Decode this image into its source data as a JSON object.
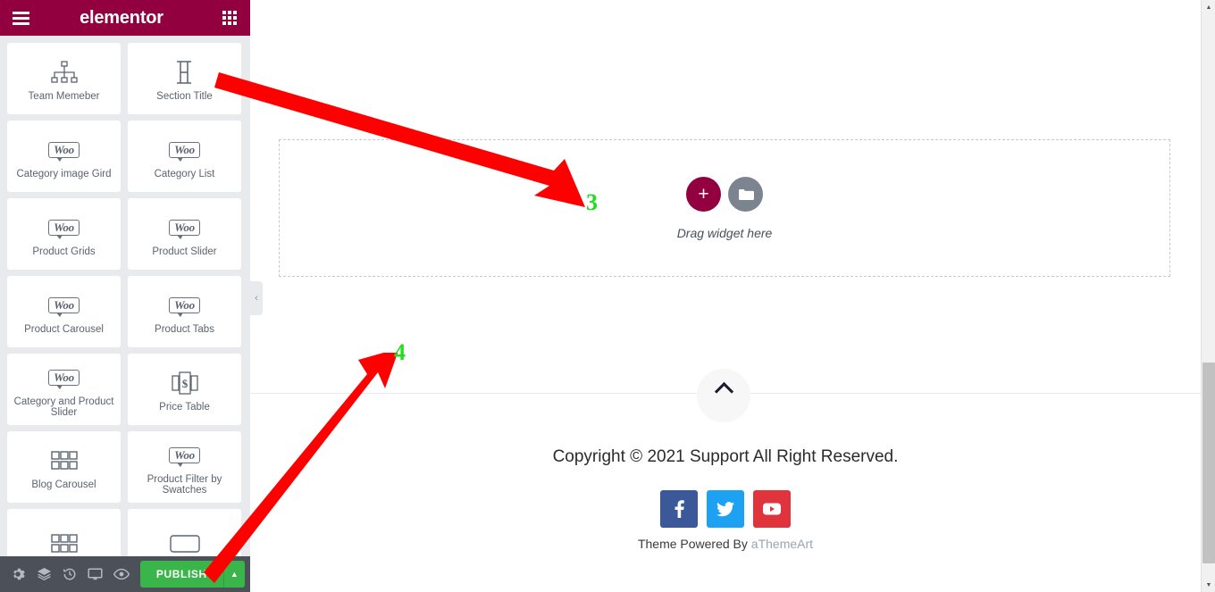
{
  "panel": {
    "logo": "elementor",
    "menu_icon": "hamburger-icon",
    "grid_icon": "apps-grid-icon",
    "collapse_icon": "‹",
    "widgets": [
      {
        "label": "Team Memeber",
        "icon": "sitemap-icon"
      },
      {
        "label": "Section Title",
        "icon": "heading-h-icon"
      },
      {
        "label": "Category image Gird",
        "icon": "woo-icon"
      },
      {
        "label": "Category List",
        "icon": "woo-icon"
      },
      {
        "label": "Product Grids",
        "icon": "woo-icon"
      },
      {
        "label": "Product Slider",
        "icon": "woo-icon"
      },
      {
        "label": "Product Carousel",
        "icon": "woo-icon"
      },
      {
        "label": "Product Tabs",
        "icon": "woo-icon"
      },
      {
        "label": "Category and Product Slider",
        "icon": "woo-icon"
      },
      {
        "label": "Price Table",
        "icon": "price-table-icon"
      },
      {
        "label": "Blog Carousel",
        "icon": "grid-blocks-icon"
      },
      {
        "label": "Product Filter by Swatches",
        "icon": "woo-icon"
      },
      {
        "label": "",
        "icon": "grid-blocks-icon"
      },
      {
        "label": "",
        "icon": "box-outline-icon"
      }
    ],
    "woo_text": "Woo"
  },
  "bottom_bar": {
    "tools": [
      {
        "name": "settings-icon",
        "title": "Settings"
      },
      {
        "name": "layers-icon",
        "title": "Navigator"
      },
      {
        "name": "history-icon",
        "title": "History"
      },
      {
        "name": "responsive-icon",
        "title": "Responsive Mode"
      },
      {
        "name": "preview-eye-icon",
        "title": "Preview Changes"
      }
    ],
    "publish_label": "PUBLISH",
    "publish_caret": "▲",
    "publish_color": "#39b54a"
  },
  "canvas": {
    "drop_area": {
      "add_label": "+",
      "template_icon": "folder-icon",
      "hint": "Drag widget here"
    },
    "scroll_top_icon": "chevron-up-icon",
    "copyright": "Copyright © 2021 Support All Right Reserved.",
    "social": [
      {
        "name": "facebook-icon",
        "glyph": "f",
        "color": "#3b5998"
      },
      {
        "name": "twitter-icon",
        "glyph": "🐦",
        "color": "#1da1f2"
      },
      {
        "name": "youtube-icon",
        "glyph": "▶",
        "color": "#e0343c"
      }
    ],
    "powered_prefix": "Theme Powered By ",
    "powered_brand": "aThemeArt"
  },
  "annotations": [
    {
      "number": "3",
      "color": "#22dd22"
    },
    {
      "number": "4",
      "color": "#22dd22"
    }
  ],
  "scrollbar": {
    "up_arrow": "▲",
    "down_arrow": "▼"
  },
  "colors": {
    "brand_crimson": "#93003f",
    "panel_bg": "#e8eaed",
    "bottom_bar": "#4b5059",
    "annotation_green": "#22dd22",
    "annotation_red": "#fe0000"
  }
}
